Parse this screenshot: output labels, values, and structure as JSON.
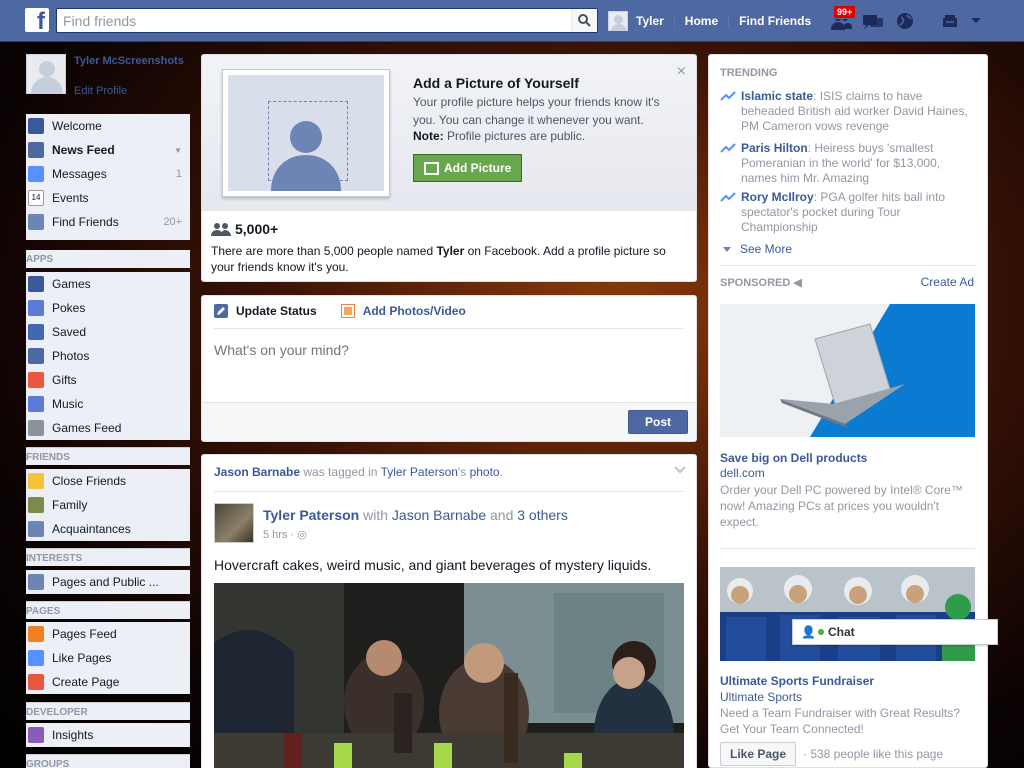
{
  "topbar": {
    "logo": "f",
    "search_placeholder": "Find friends",
    "user_name": "Tyler",
    "home_label": "Home",
    "find_friends_label": "Find Friends",
    "notif_badge": "99+"
  },
  "sidebar": {
    "profile_name": "Tyler McScreenshots",
    "edit_profile": "Edit Profile",
    "main_items": [
      {
        "label": "Welcome",
        "icon": "facebook-icon",
        "count": "",
        "color": "#3b5998"
      },
      {
        "label": "News Feed",
        "icon": "news-feed-icon",
        "count": "",
        "color": "#4e69a2"
      },
      {
        "label": "Messages",
        "icon": "messages-icon",
        "count": "1",
        "color": "#5890ff"
      },
      {
        "label": "Events",
        "icon": "calendar-icon",
        "count": "",
        "color": "#ffffff"
      },
      {
        "label": "Find Friends",
        "icon": "find-friends-icon",
        "count": "20+",
        "color": "#6d84b4"
      }
    ],
    "apps_header": "APPS",
    "apps": [
      {
        "label": "Games",
        "icon": "games-icon",
        "color": "#3b5998"
      },
      {
        "label": "Pokes",
        "icon": "pokes-icon",
        "color": "#5b7bd5"
      },
      {
        "label": "Saved",
        "icon": "saved-icon",
        "color": "#4267b2"
      },
      {
        "label": "Photos",
        "icon": "photos-icon",
        "color": "#4e69a2"
      },
      {
        "label": "Gifts",
        "icon": "gifts-icon",
        "color": "#e9573f"
      },
      {
        "label": "Music",
        "icon": "music-icon",
        "color": "#5b7bd5"
      },
      {
        "label": "Games Feed",
        "icon": "games-feed-icon",
        "color": "#8c939d"
      }
    ],
    "friends_header": "FRIENDS",
    "friends": [
      {
        "label": "Close Friends",
        "icon": "star-icon",
        "color": "#f5c33b"
      },
      {
        "label": "Family",
        "icon": "home-icon",
        "color": "#7b8a4d"
      },
      {
        "label": "Acquaintances",
        "icon": "acquaintances-icon",
        "color": "#6d84b4"
      }
    ],
    "interests_header": "INTERESTS",
    "interests": [
      {
        "label": "Pages and Public ...",
        "icon": "rss-icon",
        "color": "#6d84b4"
      }
    ],
    "pages_header": "PAGES",
    "pages": [
      {
        "label": "Pages Feed",
        "icon": "pages-feed-icon",
        "color": "#f08021"
      },
      {
        "label": "Like Pages",
        "icon": "like-icon",
        "color": "#5890ff"
      },
      {
        "label": "Create Page",
        "icon": "create-page-icon",
        "color": "#e9573f"
      }
    ],
    "developer_header": "DEVELOPER",
    "developer": [
      {
        "label": "Insights",
        "icon": "insights-icon",
        "color": "#8b5bb8"
      }
    ],
    "groups_header": "GROUPS"
  },
  "add_picture": {
    "title": "Add a Picture of Yourself",
    "description": "Your profile picture helps your friends know it's you. You can change it whenever you want.",
    "note_label": "Note:",
    "note_text": " Profile pictures are public.",
    "button": "Add Picture",
    "close": "×",
    "people_count": "5,000+",
    "people_text_1": "There are more than 5,000 people named ",
    "people_name": "Tyler",
    "people_text_2": " on Facebook. Add a profile picture so your friends know it's you."
  },
  "composer": {
    "tab_status": "Update Status",
    "tab_photos": "Add Photos/Video",
    "placeholder": "What's on your mind?",
    "post_button": "Post"
  },
  "story": {
    "header_actor": "Jason Barnabe",
    "header_mid": " was tagged in ",
    "header_owner": "Tyler Paterson",
    "header_owner_suffix": "'s ",
    "header_obj": "photo",
    "header_end": ".",
    "author": "Tyler Paterson",
    "with_text": " with ",
    "with_name": "Jason Barnabe",
    "and_text": " and ",
    "others": "3 others",
    "time": "5 hrs",
    "text": "Hovercraft cakes, weird music, and giant beverages of mystery liquids."
  },
  "trending": {
    "header": "TRENDING",
    "items": [
      {
        "topic": "Islamic state",
        "text": ": ISIS claims to have beheaded British aid worker David Haines, PM Cameron vows revenge"
      },
      {
        "topic": "Paris Hilton",
        "text": ": Heiress buys 'smallest Pomeranian in the world' for $13,000, names him Mr. Amazing"
      },
      {
        "topic": "Rory McIlroy",
        "text": ": PGA golfer hits ball into spectator's pocket during Tour Championship"
      }
    ],
    "see_more": "See More"
  },
  "sponsored": {
    "header": "SPONSORED",
    "create_ad": "Create Ad",
    "ad1": {
      "title": "Save big on Dell products",
      "domain": "dell.com",
      "desc": "Order your Dell PC powered by Intel® Core™ now! Amazing PCs at prices you wouldn't expect."
    },
    "ad2": {
      "title": "Ultimate Sports Fundraiser",
      "domain": "Ultimate Sports",
      "desc": "Need a Team Fundraiser with Great Results? Get Your Team Connected!",
      "button": "Like Page",
      "like_count": "· 538 people like this page"
    }
  },
  "chat": {
    "label": "Chat"
  },
  "colors": {
    "brand": "#3b5998",
    "topbar": "#4e69a2",
    "green": "#69a74e"
  }
}
